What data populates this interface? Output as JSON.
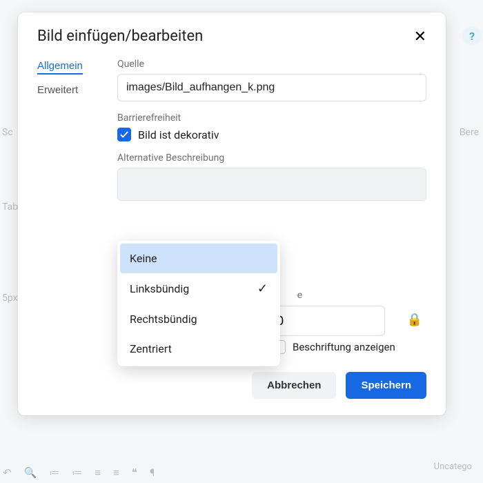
{
  "modal": {
    "title": "Bild einfügen/bearbeiten",
    "tabs": {
      "general": "Allgemein",
      "advanced": "Erweitert"
    },
    "source": {
      "label": "Quelle",
      "value": "images/Bild_aufhangen_k.png"
    },
    "a11y": {
      "label": "Barrierefreiheit",
      "decorative_label": "Bild ist dekorativ",
      "decorative_checked": true,
      "alt_label": "Alternative Beschreibung"
    },
    "dimensions": {
      "fragment_label": "e",
      "value_fragment": "0"
    },
    "align_select": {
      "value": "Linksbündig"
    },
    "align_options": [
      "Keine",
      "Linksbündig",
      "Rechtsbündig",
      "Zentriert"
    ],
    "caption": {
      "label": "Beschriftung",
      "show_label": "Beschriftung anzeigen"
    },
    "buttons": {
      "cancel": "Abbrechen",
      "save": "Speichern"
    }
  },
  "background": {
    "left1": "Sc",
    "left2": "Tab",
    "left3": "5px",
    "right1": "Bere",
    "category": "Uncatego"
  }
}
